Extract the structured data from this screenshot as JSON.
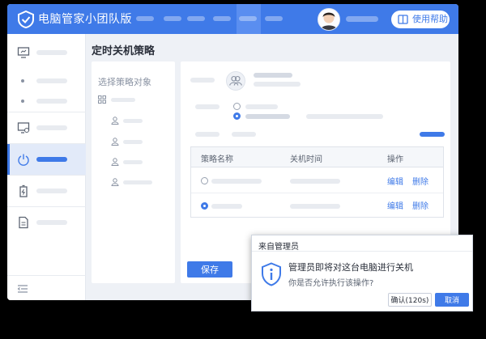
{
  "app": {
    "title": "电脑管家小团队版",
    "help_label": "使用帮助"
  },
  "page": {
    "title": "定时关机策略",
    "select_target_label": "选择策略对象",
    "save_label": "保存"
  },
  "table": {
    "headers": [
      "策略名称",
      "关机时间",
      "操作"
    ],
    "rows": [
      {
        "edit": "编辑",
        "delete": "删除"
      },
      {
        "edit": "编辑",
        "delete": "删除"
      }
    ]
  },
  "dialog": {
    "title": "来自管理员",
    "message": "管理员即将对这台电脑进行关机",
    "question": "你是否允许执行该操作?",
    "confirm_label": "确认(120s)",
    "cancel_label": "取消"
  },
  "colors": {
    "accent": "#3f7ae8",
    "placeholder": "#e8ebf0"
  },
  "icons": {
    "logo": "shield-check-icon",
    "help": "help-book-icon",
    "sidebar": [
      "monitor-icon",
      "screen-settings-icon",
      "power-icon",
      "battery-icon",
      "document-icon",
      "collapse-icon"
    ],
    "dialog": "shield-info-icon"
  }
}
